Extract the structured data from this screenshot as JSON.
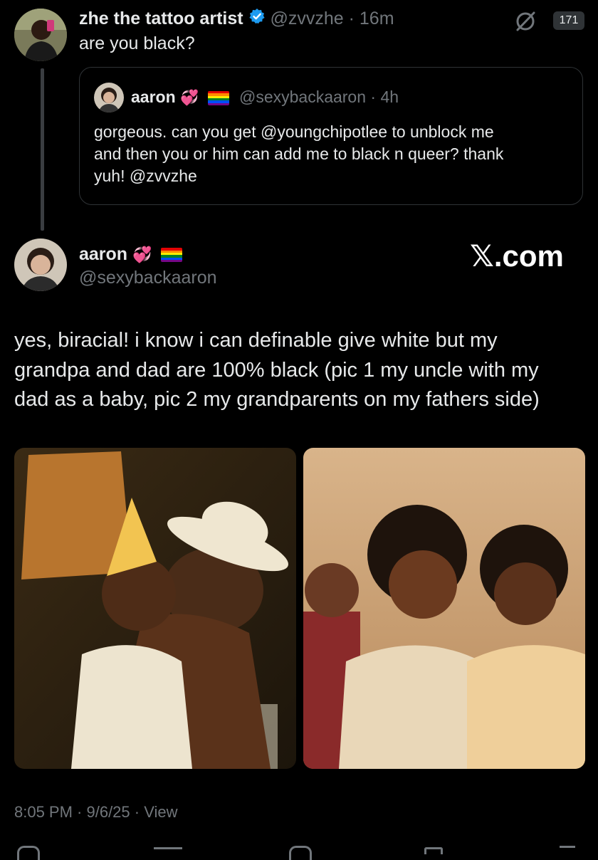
{
  "top_post": {
    "display_name": "zhe the tattoo artist",
    "handle": "@zvvzhe",
    "time": "· 16m",
    "text": "are you black?",
    "view_count": "171"
  },
  "quoted_post": {
    "display_name": "aaron",
    "handle": "@sexybackaaron",
    "time": "· 4h",
    "text_line1": "gorgeous. can you get @youngchipotlee to unblock me",
    "text_line2": "and then you or him can add me to black n queer? thank",
    "text_line3": "yuh! @zvvzhe"
  },
  "main_post": {
    "display_name": "aaron",
    "handle": "@sexybackaaron",
    "watermark": "𝕏.com",
    "text_line1": "yes, biracial! i know i can definable give white but my",
    "text_line2": "grandpa and dad are 100% black (pic 1 my uncle with my",
    "text_line3": "dad as a baby, pic 2 my grandparents on my fathers side)",
    "timestamp": "8:05 PM · 9/6/25 · ",
    "view_link": "View"
  },
  "colors": {
    "background": "#000000",
    "text": "#e7e9ea",
    "muted": "#71767b",
    "verified": "#1d9bf0",
    "border": "#2f3336"
  },
  "icons": [
    "verified-icon",
    "grok-icon",
    "heart-emoji",
    "pride-flag-icon"
  ]
}
